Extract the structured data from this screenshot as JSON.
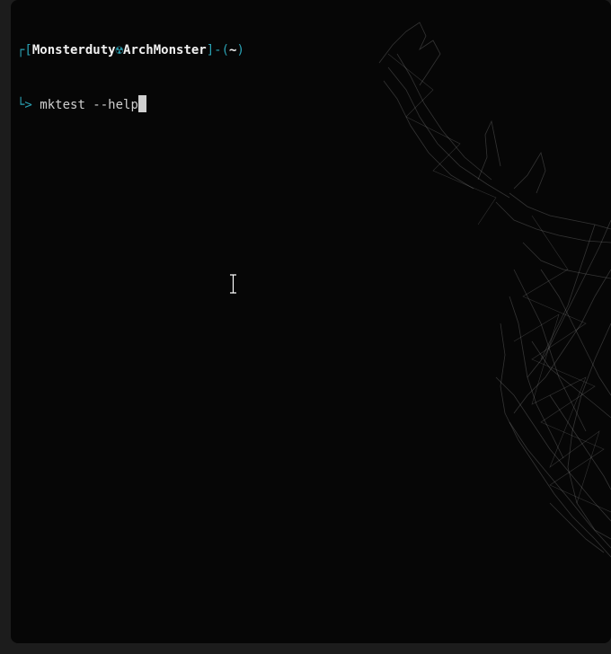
{
  "terminal": {
    "prompt": {
      "corner_top": "┌[",
      "user": "Monsterduty",
      "separator": "☢",
      "host": "ArchMonster",
      "close_bracket": "]",
      "dash": "-",
      "dir_open": "(",
      "cwd": "~",
      "dir_close": ")",
      "corner_bottom": "└> "
    },
    "command": "mktest --help"
  },
  "colors": {
    "background": "#060606",
    "accent": "#2aa1b3",
    "text": "#cfcfcf"
  },
  "icons": {
    "cursor": "ibeam-cursor-icon",
    "wallpaper": "deer-wireframe"
  }
}
